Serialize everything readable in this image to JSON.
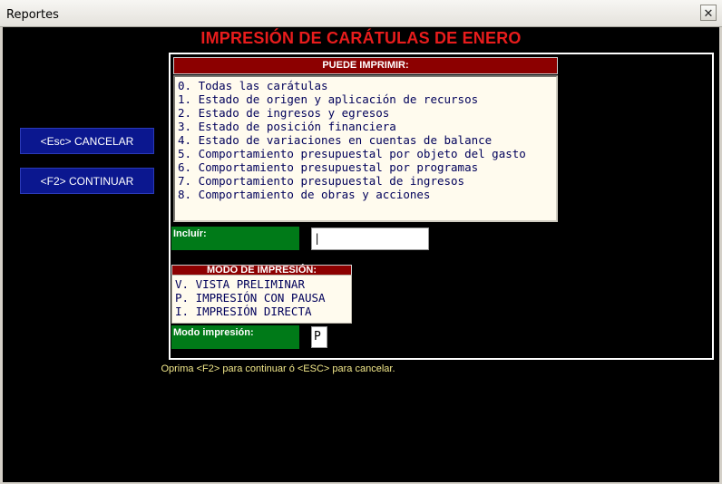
{
  "window": {
    "title": "Reportes",
    "close_glyph": "✕"
  },
  "heading": "IMPRESIÓN DE CARÁTULAS DE ENERO",
  "buttons": {
    "cancel": "<Esc> CANCELAR",
    "continue": "<F2> CONTINUAR"
  },
  "print_section": {
    "header": "PUEDE IMPRIMIR:",
    "items": [
      "0. Todas las carátulas",
      "1. Estado de origen y aplicación de recursos",
      "2. Estado de ingresos y egresos",
      "3. Estado de posición financiera",
      "4. Estado de variaciones en cuentas de balance",
      "5. Comportamiento presupuestal por objeto del gasto",
      "6. Comportamiento presupuestal por programas",
      "7. Comportamiento presupuestal de ingresos",
      "8. Comportamiento de obras y acciones"
    ]
  },
  "include": {
    "label": "Incluír:",
    "value": "|"
  },
  "mode_section": {
    "header": "MODO DE IMPRESIÓN:",
    "items": [
      "V. VISTA PRELIMINAR",
      "P. IMPRESIÓN CON PAUSA",
      "I. IMPRESIÓN DIRECTA"
    ]
  },
  "mode_field": {
    "label": "Modo impresión:",
    "value": "P"
  },
  "hint": "Oprima <F2> para continuar ó <ESC> para cancelar.",
  "colors": {
    "heading_red": "#e81c1c",
    "button_blue": "#0b178f",
    "header_red": "#8c0000",
    "label_green": "#007a18",
    "hint_yellow": "#f2e88a"
  }
}
